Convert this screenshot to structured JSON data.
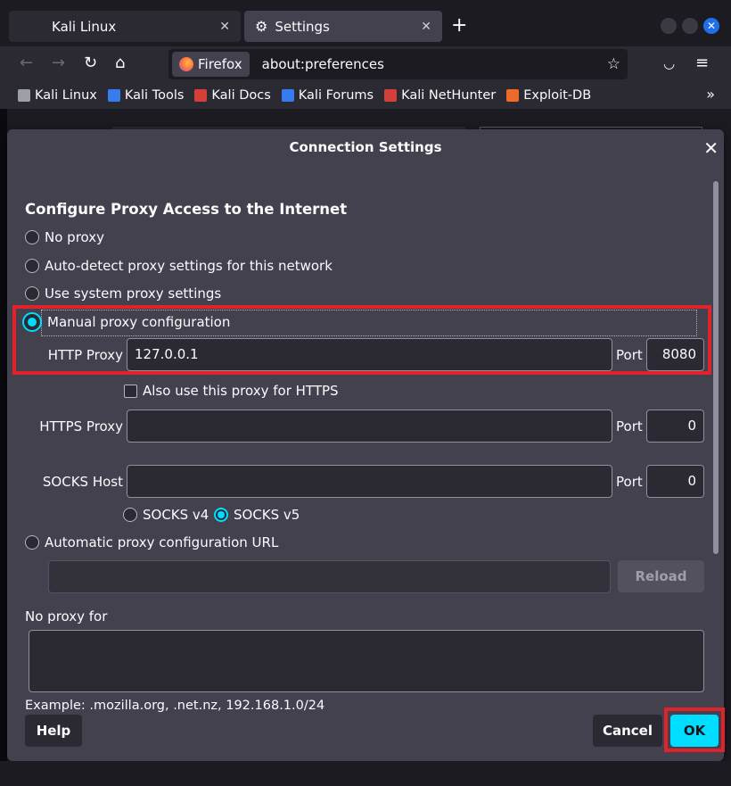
{
  "browser": {
    "tabs": [
      {
        "label": "Kali Linux",
        "close": "✕"
      },
      {
        "label": "Settings",
        "close": "✕"
      }
    ],
    "new_tab": "+",
    "identity_label": "Firefox",
    "url": "about:preferences",
    "bookmarks": [
      {
        "label": "Kali Linux",
        "color": "#9aa0a6"
      },
      {
        "label": "Kali Tools",
        "color": "#367bf0"
      },
      {
        "label": "Kali Docs",
        "color": "#d43f3a"
      },
      {
        "label": "Kali Forums",
        "color": "#367bf0"
      },
      {
        "label": "Kali NetHunter",
        "color": "#d43f3a"
      },
      {
        "label": "Exploit-DB",
        "color": "#ec6a2c"
      }
    ]
  },
  "dialog": {
    "title": "Connection Settings",
    "heading": "Configure Proxy Access to the Internet",
    "options": {
      "no_proxy": "No proxy",
      "auto_detect": "Auto-detect proxy settings for this network",
      "system": "Use system proxy settings",
      "manual": "Manual proxy configuration",
      "auto_url": "Automatic proxy configuration URL"
    },
    "selected_option": "manual",
    "http_proxy": {
      "label": "HTTP Proxy",
      "value": "127.0.0.1",
      "port_label": "Port",
      "port": "8080"
    },
    "also_https": "Also use this proxy for HTTPS",
    "https_proxy": {
      "label": "HTTPS Proxy",
      "value": "",
      "port_label": "Port",
      "port": "0"
    },
    "socks_host": {
      "label": "SOCKS Host",
      "value": "",
      "port_label": "Port",
      "port": "0"
    },
    "socks_v4": "SOCKS v4",
    "socks_v5": "SOCKS v5",
    "socks_selected": "v5",
    "auto_url_value": "",
    "reload": "Reload",
    "no_proxy_for_label": "No proxy for",
    "no_proxy_for_value": "",
    "example": "Example: .mozilla.org, .net.nz, 192.168.1.0/24",
    "help": "Help",
    "cancel": "Cancel",
    "ok": "OK"
  },
  "colors": {
    "accent": "#00ddff",
    "highlight": "#e0232a",
    "dialog_bg": "#42414d"
  }
}
